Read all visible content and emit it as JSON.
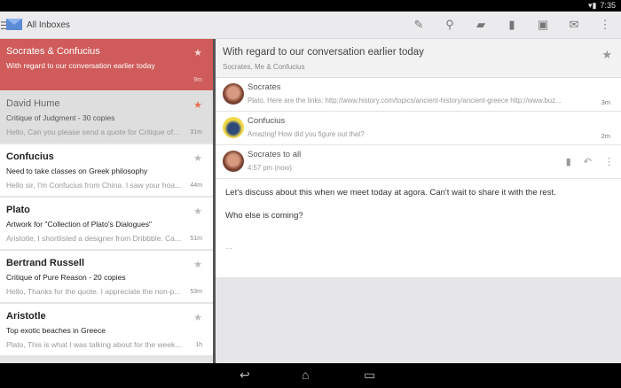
{
  "status_bar": {
    "time": "7:35"
  },
  "toolbar": {
    "account": "All Inboxes",
    "icons": [
      "compose-icon",
      "search-icon",
      "folder-icon",
      "trash-icon",
      "archive-icon",
      "mail-icon",
      "more-icon"
    ]
  },
  "colors": {
    "selected": "#cf5b5a",
    "amber": "#e0aa4a",
    "red": "#d9534f",
    "teal": "#2aa8a0"
  },
  "list": [
    {
      "from": "Socrates & Confucius",
      "subject": "With regard to our conversation earlier today",
      "snippet": "",
      "time": "9m",
      "starred": false
    },
    {
      "from": "David Hume",
      "subject": "Critique of Judgment - 30 copies",
      "snippet": "Hello, Can you please send a quote for Critique of...",
      "time": "31m",
      "starred": true
    },
    {
      "from": "Confucius",
      "subject": "Need to take classes on Greek philosophy",
      "snippet": "Hello sir, I'm Confucius from China. I saw your hoa...",
      "time": "44m",
      "starred": false
    },
    {
      "from": "Plato",
      "subject": "Artwork for \"Collection of Plato's Dialogues\"",
      "snippet": "Aristotle, I shortlisted a designer from Dribbble. Ca...",
      "time": "51m",
      "starred": false
    },
    {
      "from": "Bertrand Russell",
      "subject": "Critique of Pure Reason - 20 copies",
      "snippet": "Hello, Thanks for the quote. I appreciate the non-p...",
      "time": "53m",
      "starred": false
    },
    {
      "from": "Aristotle",
      "subject": "Top exotic beaches in Greece",
      "snippet": "Plato, This is what I was talking about for the week...",
      "time": "1h",
      "starred": false
    }
  ],
  "conversation": {
    "title": "With regard to our conversation earlier today",
    "participants": "Socrates, Me & Confucius",
    "messages": [
      {
        "from": "Socrates",
        "snippet": "Plato, Here are the links: http://www.history.com/topics/ancient-history/ancient-greece http://www.buz...",
        "time": "3m"
      },
      {
        "from": "Confucius",
        "snippet": "Amazing! How did you figure out that?",
        "time": "2m"
      }
    ],
    "open": {
      "from": "Socrates to all",
      "time": "4:57 pm (now)",
      "body": [
        "Let's discuss about this when we meet today at agora. Can't wait to share it with the rest.",
        "Who else is coming?"
      ],
      "more": "..."
    }
  }
}
